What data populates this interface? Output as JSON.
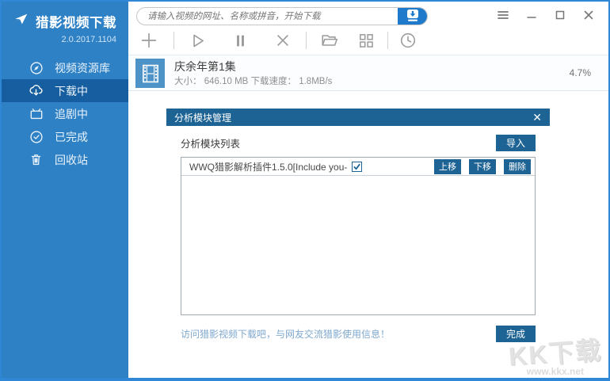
{
  "app": {
    "title": "猎影视频下载",
    "version": "2.0.2017.1104"
  },
  "search": {
    "placeholder": "请输入视频的网址、名称或拼音，开始下载",
    "button_icon": "download-icon"
  },
  "window_controls": [
    "menu-icon",
    "minimize-icon",
    "maximize-icon",
    "close-icon"
  ],
  "sidebar": {
    "items": [
      {
        "label": "视频资源库",
        "icon": "compass-icon",
        "selected": false
      },
      {
        "label": "下载中",
        "icon": "cloud-download-icon",
        "selected": true
      },
      {
        "label": "追剧中",
        "icon": "tv-icon",
        "selected": false
      },
      {
        "label": "已完成",
        "icon": "check-circle-icon",
        "selected": false
      },
      {
        "label": "回收站",
        "icon": "trash-icon",
        "selected": false
      }
    ]
  },
  "toolbar": {
    "icons": [
      "add-icon",
      "play-icon",
      "pause-icon",
      "delete-icon",
      "folder-icon",
      "grid-icon",
      "history-icon"
    ]
  },
  "downloads": [
    {
      "title": "庆余年第1集",
      "meta": "大小： 646.10 MB 下载速度： 1.8MB/s",
      "progress": "4.7%",
      "icon": "film-icon"
    }
  ],
  "modal": {
    "title": "分析模块管理",
    "list_label": "分析模块列表",
    "import_button": "导入",
    "plugins": [
      {
        "name": "WWQ猎影解析插件1.5.0[Include you-",
        "checked": true
      }
    ],
    "row_buttons": {
      "move_up": "上移",
      "move_down": "下移",
      "delete": "删除"
    },
    "footer_link": "访问猎影视频下载吧，与网友交流猎影使用信息！",
    "done_button": "完成"
  },
  "watermark": {
    "title": "KK下载",
    "url": "www.kkx.net"
  },
  "colors": {
    "sidebar": "#2E81C5",
    "sidebar_selected": "#165E9F",
    "header_blue": "#1D6394",
    "accent_blue": "#1F7ACC",
    "window_border": "#2F87D6",
    "link": "#7FA8CE"
  }
}
